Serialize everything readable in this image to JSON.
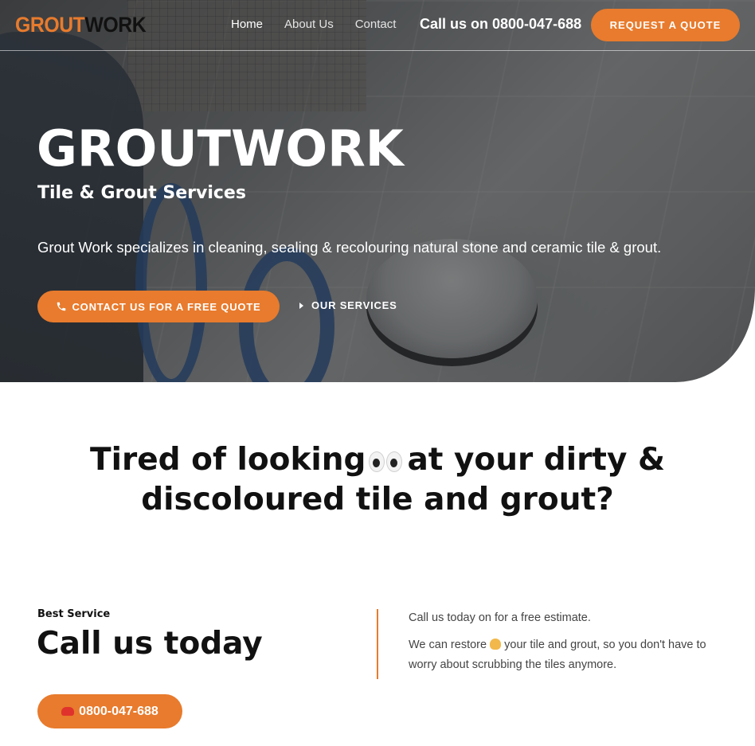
{
  "header": {
    "logo_part1": "GROUT",
    "logo_part2": "WORK",
    "nav": [
      {
        "label": "Home",
        "active": true
      },
      {
        "label": "About Us",
        "active": false
      },
      {
        "label": "Contact",
        "active": false
      }
    ],
    "phone_text": "Call us on 0800-047-688",
    "quote_button": "REQUEST A QUOTE"
  },
  "hero": {
    "title": "GROUTWORK",
    "subtitle": "Tile & Grout Services",
    "description": "Grout Work specializes in cleaning, sealing & recolouring natural stone and ceramic tile & grout.",
    "contact_button": "CONTACT US FOR A FREE QUOTE",
    "services_link": "OUR SERVICES"
  },
  "tagline": {
    "line1_before": "Tired of looking",
    "line1_after": "at your dirty &",
    "line2": "discoloured tile and grout?"
  },
  "cta": {
    "eyebrow": "Best Service",
    "title": "Call us today",
    "paragraph1": "Call us today on for a free estimate.",
    "paragraph2_before": "We can restore",
    "paragraph2_after": "your tile and grout, so you don't have to worry about scrubbing the tiles anymore.",
    "phone_button": "0800-047-688"
  },
  "colors": {
    "accent": "#e87b2d",
    "text_dark": "#111111",
    "text_body": "#444444"
  }
}
